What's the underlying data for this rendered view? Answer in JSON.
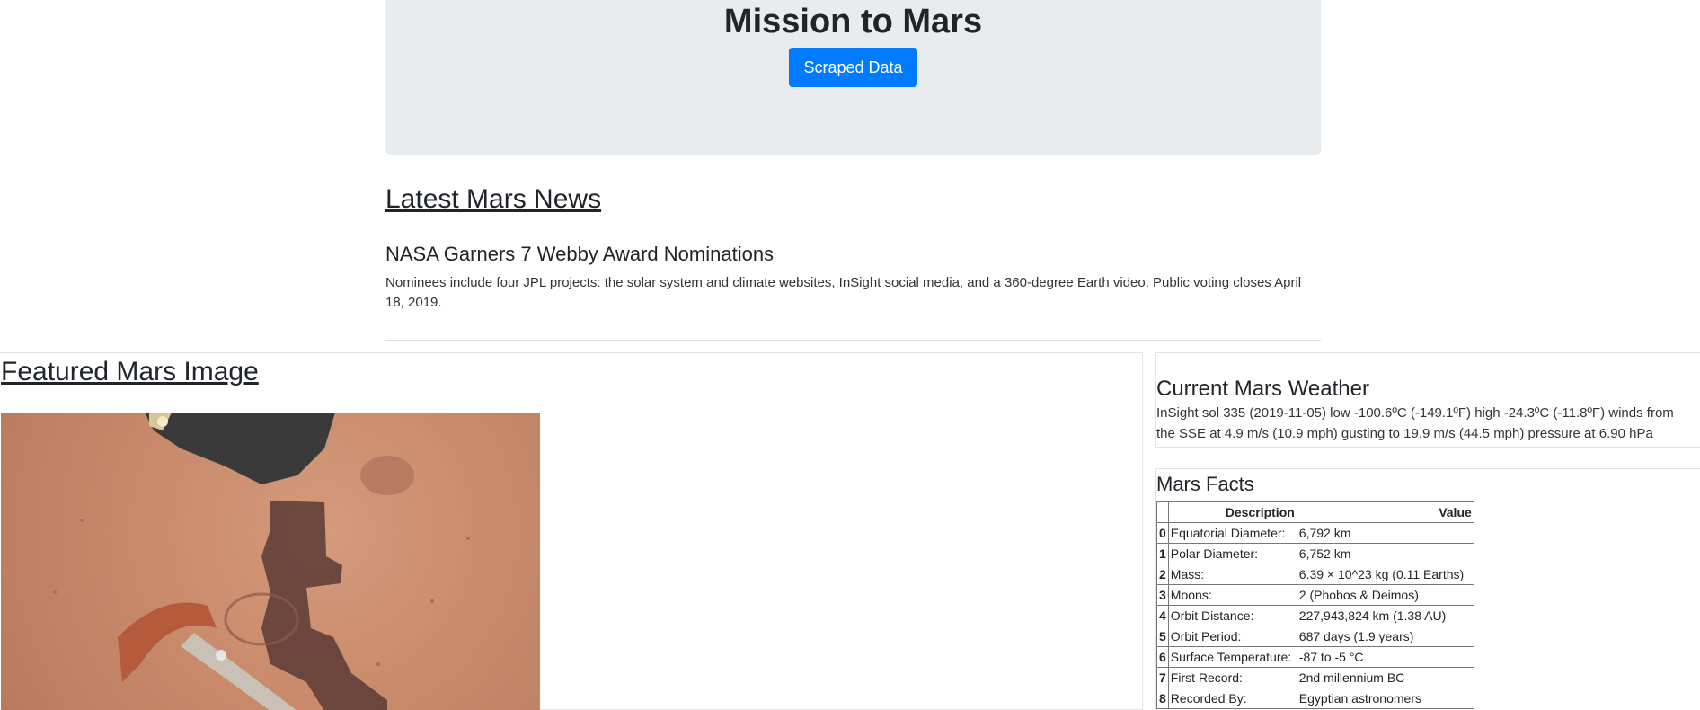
{
  "jumbotron": {
    "title": "Mission to Mars",
    "button_label": "Scraped Data"
  },
  "news": {
    "section_title": "Latest Mars News",
    "headline": "NASA Garners 7 Webby Award Nominations",
    "teaser": "Nominees include four JPL projects: the solar system and climate websites, InSight social media, and a 360-degree Earth video. Public voting closes April 18, 2019."
  },
  "featured": {
    "section_title": "Featured Mars Image"
  },
  "weather": {
    "section_title": "Current Mars Weather",
    "text": "InSight sol 335 (2019-11-05) low -100.6ºC (-149.1ºF) high -24.3ºC (-11.8ºF) winds from the SSE at 4.9 m/s (10.9 mph) gusting to 19.9 m/s (44.5 mph) pressure at 6.90 hPa"
  },
  "facts": {
    "section_title": "Mars Facts",
    "headers": [
      "Description",
      "Value"
    ],
    "rows": [
      {
        "idx": "0",
        "desc": "Equatorial Diameter:",
        "val": "6,792 km"
      },
      {
        "idx": "1",
        "desc": "Polar Diameter:",
        "val": "6,752 km"
      },
      {
        "idx": "2",
        "desc": "Mass:",
        "val": "6.39 × 10^23 kg (0.11 Earths)"
      },
      {
        "idx": "3",
        "desc": "Moons:",
        "val": "2 (Phobos & Deimos)"
      },
      {
        "idx": "4",
        "desc": "Orbit Distance:",
        "val": "227,943,824 km (1.38 AU)"
      },
      {
        "idx": "5",
        "desc": "Orbit Period:",
        "val": "687 days (1.9 years)"
      },
      {
        "idx": "6",
        "desc": "Surface Temperature:",
        "val": "-87 to -5 °C"
      },
      {
        "idx": "7",
        "desc": "First Record:",
        "val": "2nd millennium BC"
      },
      {
        "idx": "8",
        "desc": "Recorded By:",
        "val": "Egyptian astronomers"
      }
    ]
  }
}
